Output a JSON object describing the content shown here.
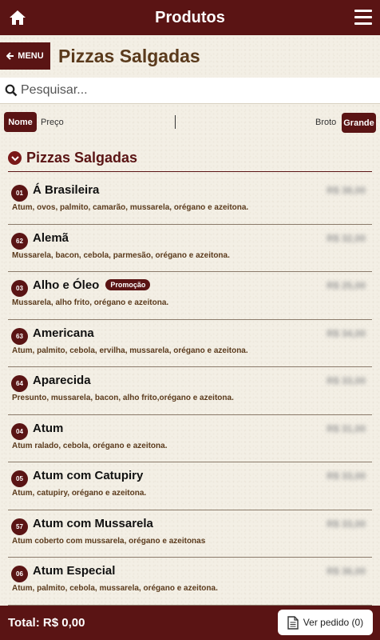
{
  "topbar": {
    "title": "Produtos"
  },
  "nav": {
    "back_label": "MENU"
  },
  "page": {
    "heading": "Pizzas Salgadas"
  },
  "search": {
    "placeholder": "Pesquisar...",
    "value": ""
  },
  "sort": {
    "name_label": "Nome",
    "price_label": "Preço",
    "small_label": "Broto",
    "large_label": "Grande"
  },
  "section": {
    "title": "Pizzas Salgadas"
  },
  "products": [
    {
      "code": "01",
      "name": "Á Brasileira",
      "desc": "Atum, ovos, palmito, camarão, mussarela, orégano e azeitona.",
      "price": "R$ 38,00",
      "promo": ""
    },
    {
      "code": "62",
      "name": "Alemã",
      "desc": "Mussarela, bacon, cebola, parmesão, orégano e azeitona.",
      "price": "R$ 32,00",
      "promo": ""
    },
    {
      "code": "03",
      "name": "Alho e Óleo",
      "desc": "Mussarela, alho frito, orégano e azeitona.",
      "price": "R$ 25,00",
      "promo": "Promoção"
    },
    {
      "code": "63",
      "name": "Americana",
      "desc": "Atum, palmito, cebola, ervilha, mussarela, orégano e azeitona.",
      "price": "R$ 34,00",
      "promo": ""
    },
    {
      "code": "64",
      "name": "Aparecida",
      "desc": "Presunto, mussarela, bacon, alho frito,orégano e azeitona.",
      "price": "R$ 33,00",
      "promo": ""
    },
    {
      "code": "04",
      "name": "Atum",
      "desc": "Atum ralado, cebola, orégano e azeitona.",
      "price": "R$ 31,00",
      "promo": ""
    },
    {
      "code": "05",
      "name": "Atum com Catupiry",
      "desc": "Atum, catupiry, orégano e azeitona.",
      "price": "R$ 33,00",
      "promo": ""
    },
    {
      "code": "57",
      "name": "Atum com Mussarela",
      "desc": "Atum coberto com mussarela, orégano e azeitonas",
      "price": "R$ 33,00",
      "promo": ""
    },
    {
      "code": "06",
      "name": "Atum Especial",
      "desc": "Atum, palmito, cebola, mussarela, orégano e azeitona.",
      "price": "R$ 36,00",
      "promo": ""
    }
  ],
  "footer": {
    "total": "Total: R$ 0,00",
    "order_label": "Ver pedido (0)"
  },
  "colors": {
    "primary": "#5a1414",
    "background": "#f3efe5",
    "heading": "#5a3a1c"
  },
  "icons": [
    "home-icon",
    "hamburger-menu-icon",
    "arrow-left-icon",
    "search-icon",
    "chevron-down-icon",
    "document-icon"
  ]
}
